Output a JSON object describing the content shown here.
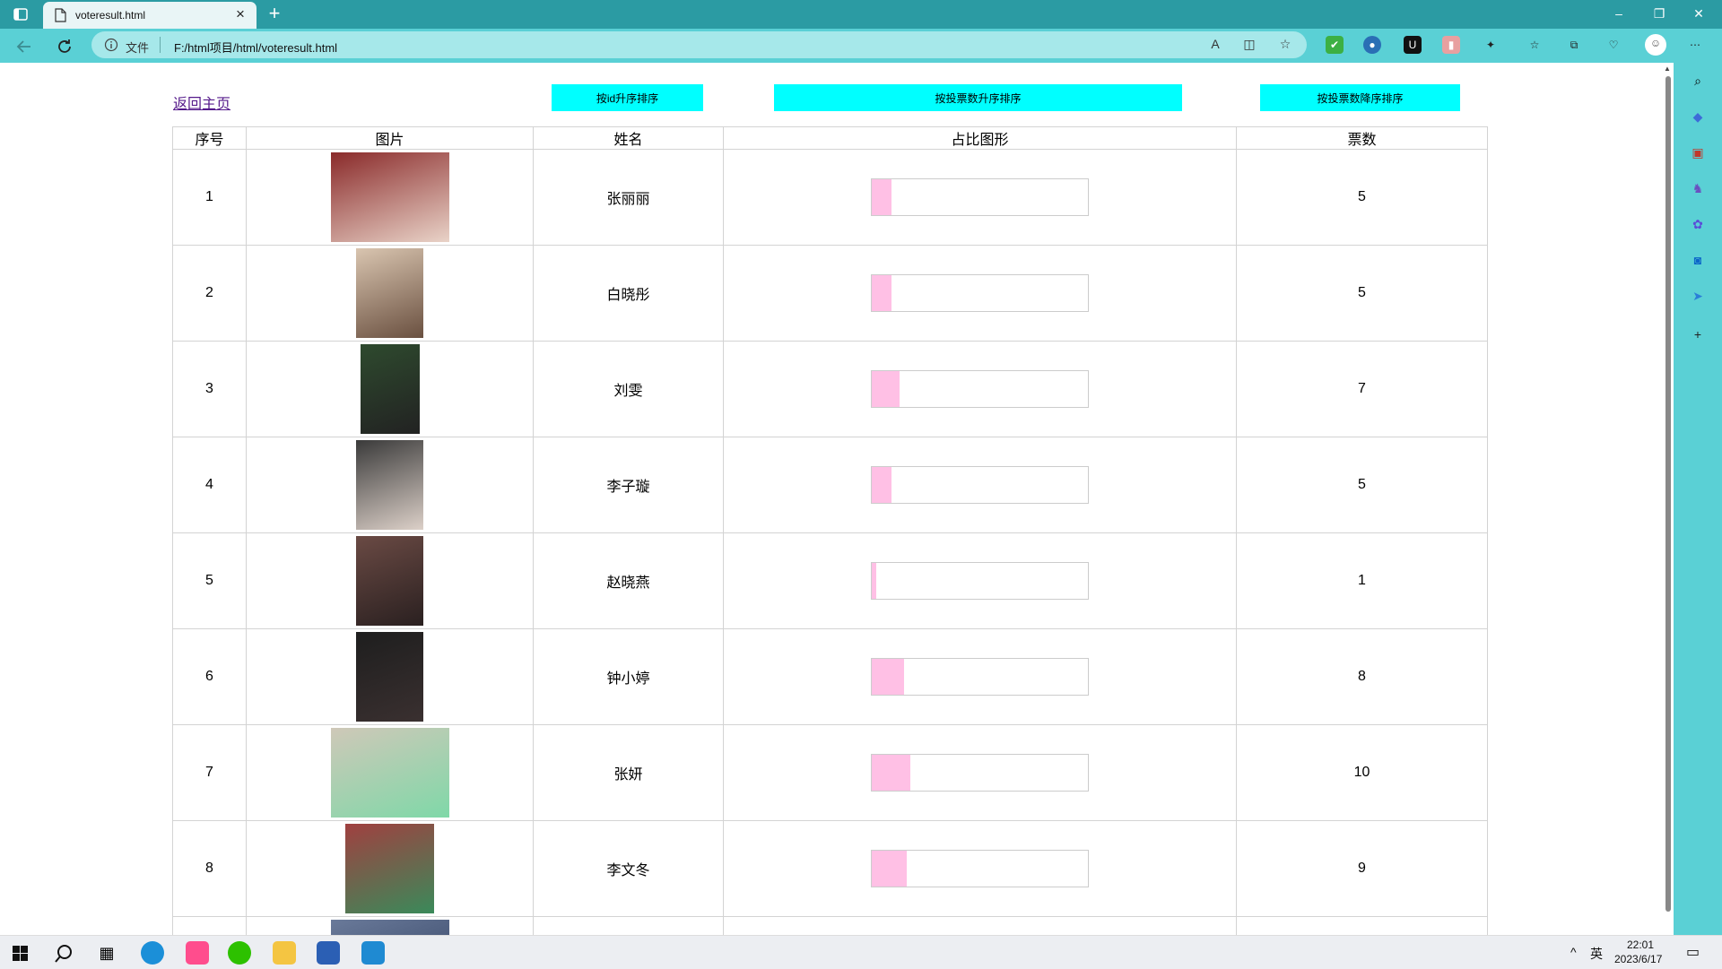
{
  "browser": {
    "tab_title": "voteresult.html",
    "file_label": "文件",
    "url": "F:/html项目/html/voteresult.html"
  },
  "page": {
    "back_link": "返回主页",
    "buttons": {
      "sort_id_asc": "按id升序排序",
      "sort_votes_asc": "按投票数升序排序",
      "sort_votes_desc": "按投票数降序排序"
    },
    "table": {
      "headers": [
        "序号",
        "图片",
        "姓名",
        "占比图形",
        "票数"
      ],
      "rows": [
        {
          "id": "1",
          "name": "张丽丽",
          "votes": "5",
          "ratio": 0.09
        },
        {
          "id": "2",
          "name": "白晓彤",
          "votes": "5",
          "ratio": 0.09
        },
        {
          "id": "3",
          "name": "刘雯",
          "votes": "7",
          "ratio": 0.13
        },
        {
          "id": "4",
          "name": "李子璇",
          "votes": "5",
          "ratio": 0.09
        },
        {
          "id": "5",
          "name": "赵晓燕",
          "votes": "1",
          "ratio": 0.02
        },
        {
          "id": "6",
          "name": "钟小婷",
          "votes": "8",
          "ratio": 0.15
        },
        {
          "id": "7",
          "name": "张妍",
          "votes": "10",
          "ratio": 0.18
        },
        {
          "id": "8",
          "name": "李文冬",
          "votes": "9",
          "ratio": 0.16
        }
      ]
    }
  },
  "taskbar": {
    "ime": "英",
    "time": "22:01",
    "date": "2023/6/17"
  },
  "colors": {
    "chrome_dark": "#2b9ba3",
    "chrome_light": "#5ad0d5",
    "button_bg": "#00ffff",
    "bar_fill": "#ffc0e5",
    "link": "#551a8b"
  }
}
